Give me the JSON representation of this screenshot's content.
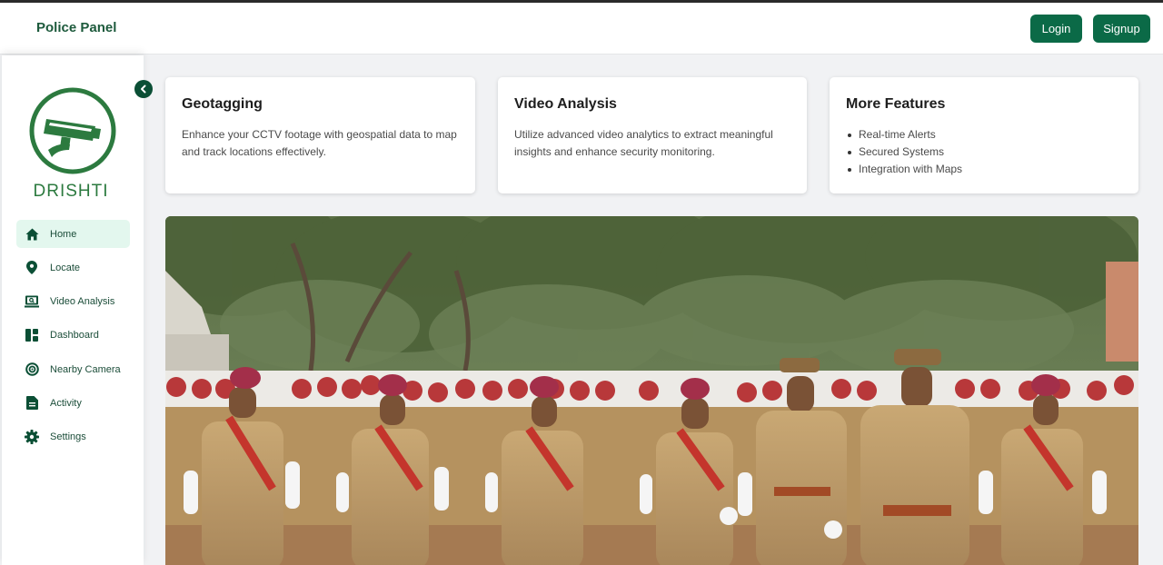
{
  "header": {
    "title": "Police Panel",
    "login_label": "Login",
    "signup_label": "Signup"
  },
  "sidebar": {
    "logo_text": "DRISHTI",
    "items": [
      {
        "label": "Home",
        "icon": "home-icon",
        "active": true
      },
      {
        "label": "Locate",
        "icon": "location-pin-icon",
        "active": false
      },
      {
        "label": "Video Analysis",
        "icon": "video-analysis-icon",
        "active": false
      },
      {
        "label": "Dashboard",
        "icon": "dashboard-icon",
        "active": false
      },
      {
        "label": "Nearby Camera",
        "icon": "target-icon",
        "active": false
      },
      {
        "label": "Activity",
        "icon": "document-icon",
        "active": false
      },
      {
        "label": "Settings",
        "icon": "gear-icon",
        "active": false
      }
    ]
  },
  "cards": [
    {
      "title": "Geotagging",
      "text": "Enhance your CCTV footage with geospatial data to map and track locations effectively."
    },
    {
      "title": "Video Analysis",
      "text": "Utilize advanced video analytics to extract meaningful insights and enhance security monitoring."
    },
    {
      "title": "More Features",
      "items": [
        "Real-time Alerts",
        "Secured Systems",
        "Integration with Maps"
      ]
    }
  ],
  "hero": {
    "icon": "police-parade-photo"
  },
  "colors": {
    "primary": "#0b6a47",
    "brand_text": "#1d5a3c",
    "logo_green": "#2c7a3f",
    "active_bg": "#e3f7ee"
  }
}
